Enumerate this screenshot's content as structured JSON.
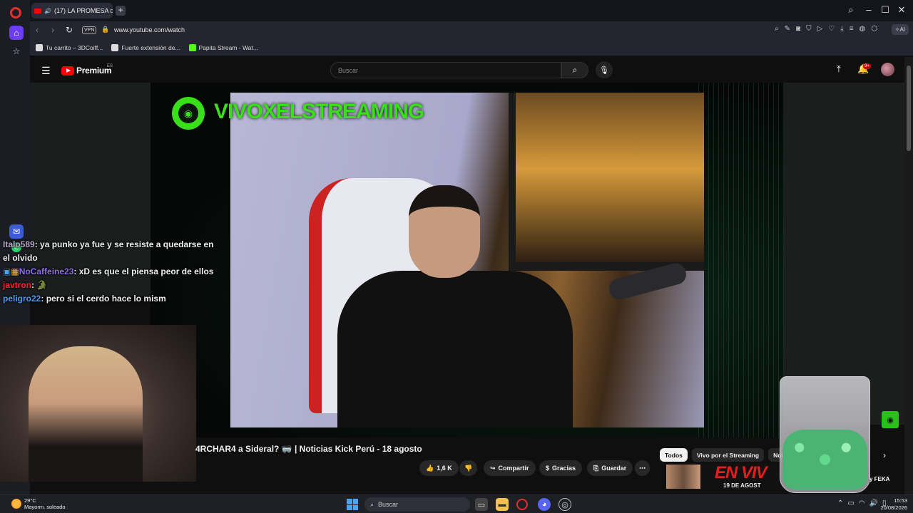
{
  "browser": {
    "tab_title": "(17) LA PROMESA de",
    "url": "www.youtube.com/watch",
    "vpn_label": "VPN",
    "ai_label": "AI",
    "bookmarks": [
      {
        "label": "Tu carrito – 3DCoiff..."
      },
      {
        "label": "Fuerte extensión de..."
      },
      {
        "label": "Papita Stream - Wat..."
      }
    ]
  },
  "youtube": {
    "logo_text": "Premium",
    "region": "ES",
    "search_placeholder": "Buscar",
    "notification_count": "9+"
  },
  "video": {
    "channel_overlay": "VIVOXELSTREAMING",
    "title": "4RCHAR4 a Sideral? 🥽 | Noticias Kick Perú - 18 agosto",
    "likes": "1,6 K",
    "share_label": "Compartir",
    "thanks_label": "Gracias",
    "save_label": "Guardar"
  },
  "chat": [
    {
      "user": "Italo589",
      "color": "#b7a6c8",
      "text": ": ya punko ya fue y se resiste a quedarse en el olvido"
    },
    {
      "user": "NoCaffeine23",
      "color": "#8f6cf0",
      "text": ": xD es que el piensa peor de ellos"
    },
    {
      "user": "javtron",
      "color": "#ff2a2a",
      "text": ":"
    },
    {
      "user": "peligro22",
      "color": "#4f9cf0",
      "text": ": pero si el cerdo hace lo mism"
    }
  ],
  "chips": [
    {
      "label": "Todos",
      "active": true
    },
    {
      "label": "Vivo por el Streaming",
      "active": false
    },
    {
      "label": "Notic",
      "active": false
    }
  ],
  "live_banner": {
    "text": "EN VIV",
    "sub": "19 DE AGOST",
    "partner": "y FEKA"
  },
  "taskbar": {
    "temp": "29°C",
    "weather": "Mayorm. soleado",
    "search_label": "Buscar",
    "time": "15:53",
    "date": "20/08/2026"
  }
}
